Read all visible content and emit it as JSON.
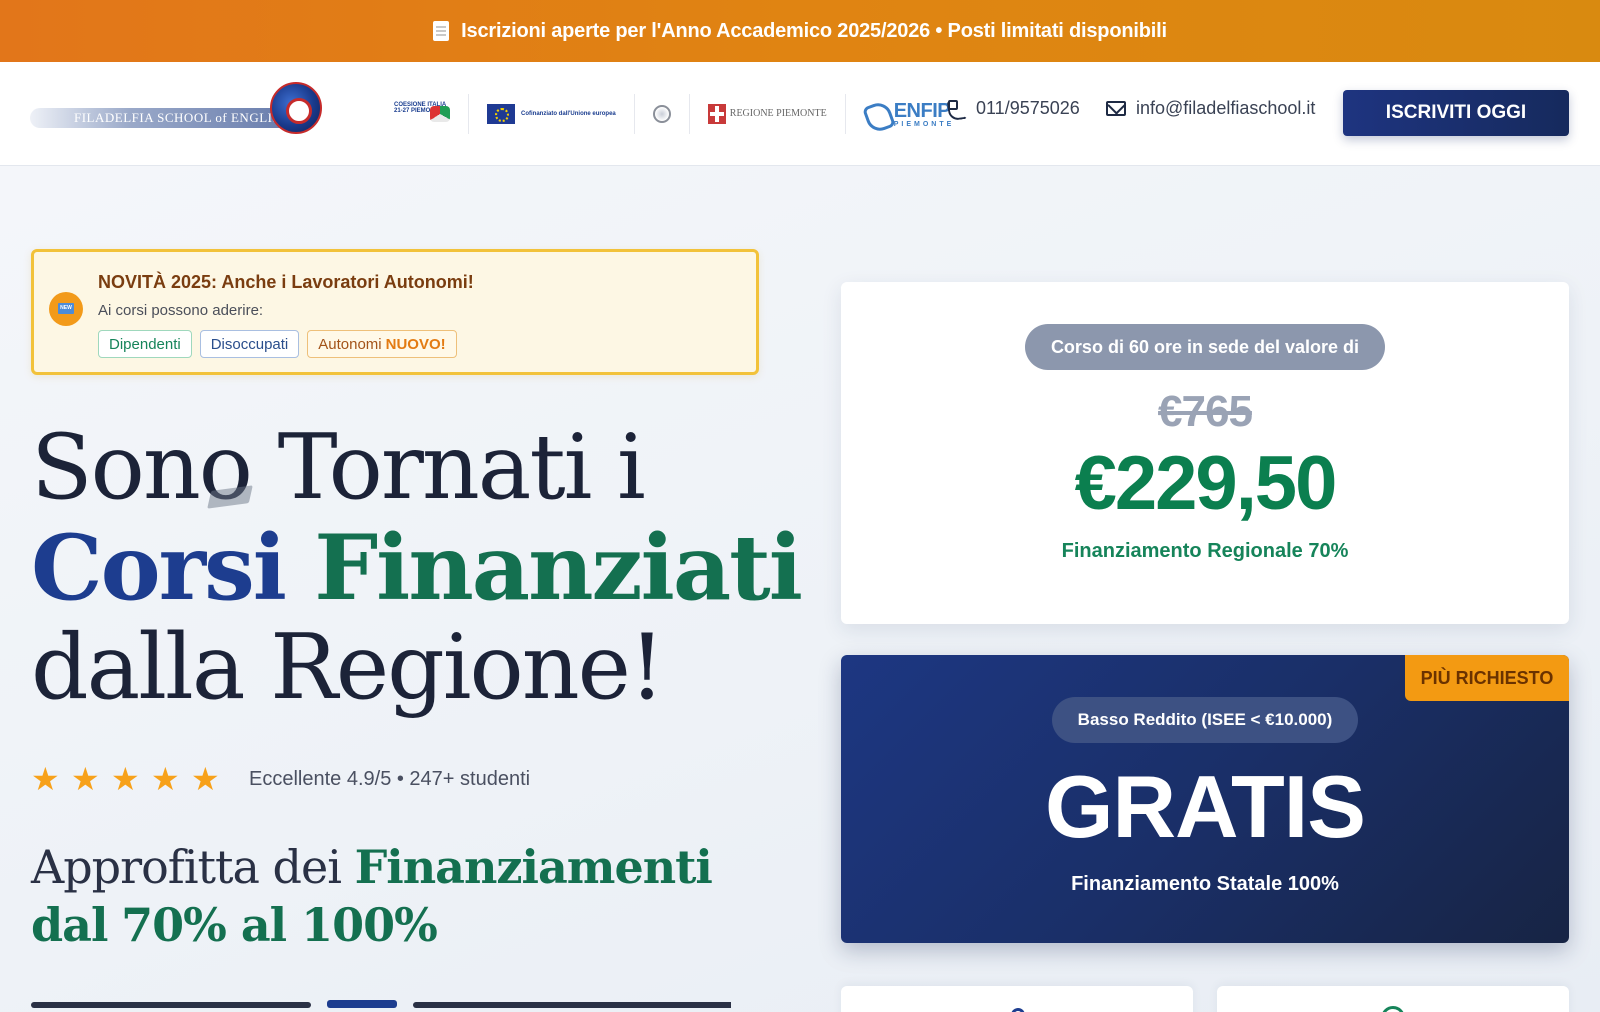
{
  "announcement": {
    "icon": "clipboard-icon",
    "text": "Iscrizioni aperte per l'Anno Accademico 2025/2026 • Posti limitati disponibili"
  },
  "header": {
    "logo_text": "FILADELFIA SCHOOL of ENGLISH",
    "partners": {
      "coesione": "COESIONE ITALIA 21-27 PIEMONTE",
      "ue": "Cofinanziato dall'Unione europea",
      "regione": "REGIONE PIEMONTE",
      "enfip_name": "ENFIP",
      "enfip_sub": "PIEMONTE"
    },
    "phone": "011/9575026",
    "email": "info@filadelfiaschool.it",
    "cta_label": "ISCRIVITI OGGI"
  },
  "news": {
    "badge": "NEW",
    "title": "NOVITÀ 2025: Anche i Lavoratori Autonomi!",
    "subtitle": "Ai corsi possono aderire:",
    "chips": [
      {
        "label": "Dipendenti"
      },
      {
        "label": "Disoccupati"
      },
      {
        "label": "Autonomi",
        "tag": "NUOVO!"
      }
    ]
  },
  "hero": {
    "line1": "Sono Tornati i",
    "line2a": "Corsi",
    "line2b": "Finanziati",
    "line3": "dalla Regione!",
    "rating_stars": 5,
    "rating_text": "Eccellente 4.9/5 • 247+ studenti",
    "subhead_a": "Approfitta dei",
    "subhead_b": "Finanziamenti dal",
    "subhead_c": "70% al 100%"
  },
  "price_card": {
    "pill": "Corso di 60 ore in sede del valore di",
    "old_price": "€765",
    "new_price": "€229,50",
    "funding": "Finanziamento Regionale 70%"
  },
  "free_card": {
    "ribbon": "PIÙ RICHIESTO",
    "pill": "Basso Reddito (ISEE < €10.000)",
    "big": "GRATIS",
    "funding": "Finanziamento Statale 100%"
  },
  "colors": {
    "accent_orange": "#e08412",
    "navy": "#1d3782",
    "green": "#0b7f4f"
  }
}
